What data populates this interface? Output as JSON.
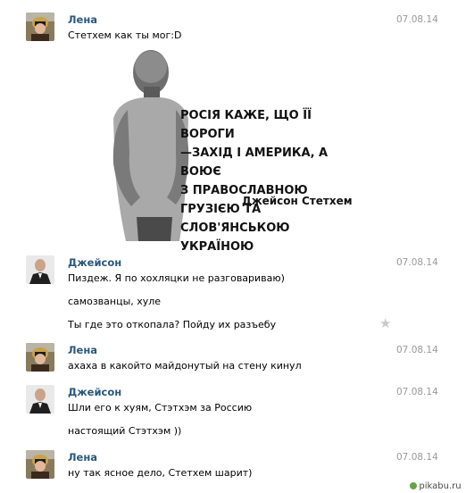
{
  "messages": [
    {
      "author": "Лена",
      "date": "07.08.14",
      "avatar_icon": "girl-avatar-icon",
      "lines": [
        "Стетхем как ты мог:D"
      ]
    },
    {
      "author": "Джейсон",
      "date": "07.08.14",
      "avatar_icon": "man-avatar-icon",
      "lines": [
        "Пиздеж. Я по хохляцки не разговариваю)",
        "самозванцы, хуле",
        "Ты где это откопала? Пойду их разъебу"
      ]
    },
    {
      "author": "Лена",
      "date": "07.08.14",
      "avatar_icon": "girl-avatar-icon",
      "lines": [
        "ахаха в какойто майдонутый на стену кинул"
      ]
    },
    {
      "author": "Джейсон",
      "date": "07.08.14",
      "avatar_icon": "man-avatar-icon",
      "lines": [
        "Шли его к хуям, Стэтхэм за Россию",
        "настоящий Стэтхэм ))"
      ]
    },
    {
      "author": "Лена",
      "date": "07.08.14",
      "avatar_icon": "girl-avatar-icon",
      "lines": [
        "ну так ясное дело, Стетхем шарит)"
      ]
    }
  ],
  "attachment": {
    "quote": "РОСІЯ КАЖЕ, ЩО ЇЇ ВОРОГИ\n—ЗАХІД І АМЕРИКА, А ВОЮЄ\nЗ ПРАВОСЛАВНОЮ ГРУЗІЄЮ ТА\nСЛОВ'ЯНСЬКОЮ УКРАЇНОЮ",
    "author": "Джейсон Стетхем"
  },
  "watermark": "pikabu.ru",
  "colors": {
    "author": "#2b587a",
    "date": "#999999",
    "star": "#c9c9c9"
  }
}
